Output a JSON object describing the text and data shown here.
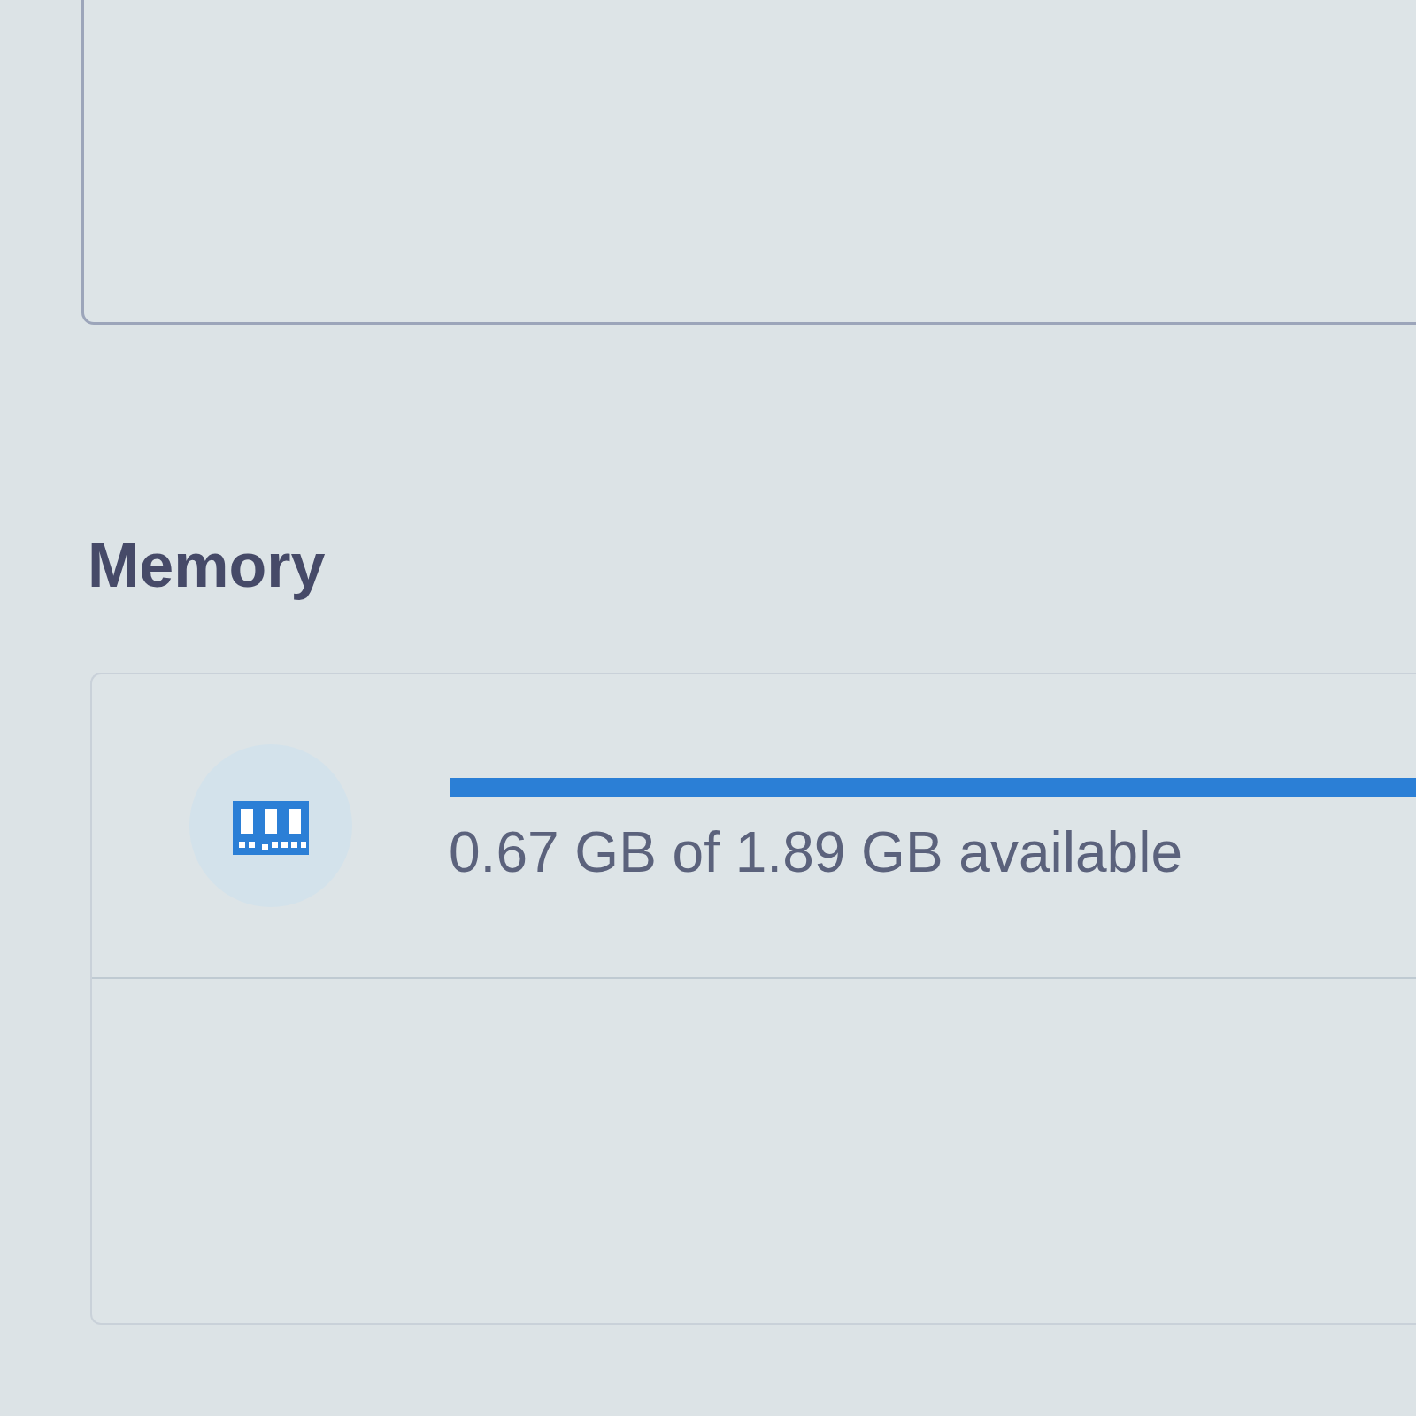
{
  "memory": {
    "title": "Memory",
    "usage": {
      "level": 1,
      "reading": "0.67 GB of 1.89 GB available"
    }
  }
}
